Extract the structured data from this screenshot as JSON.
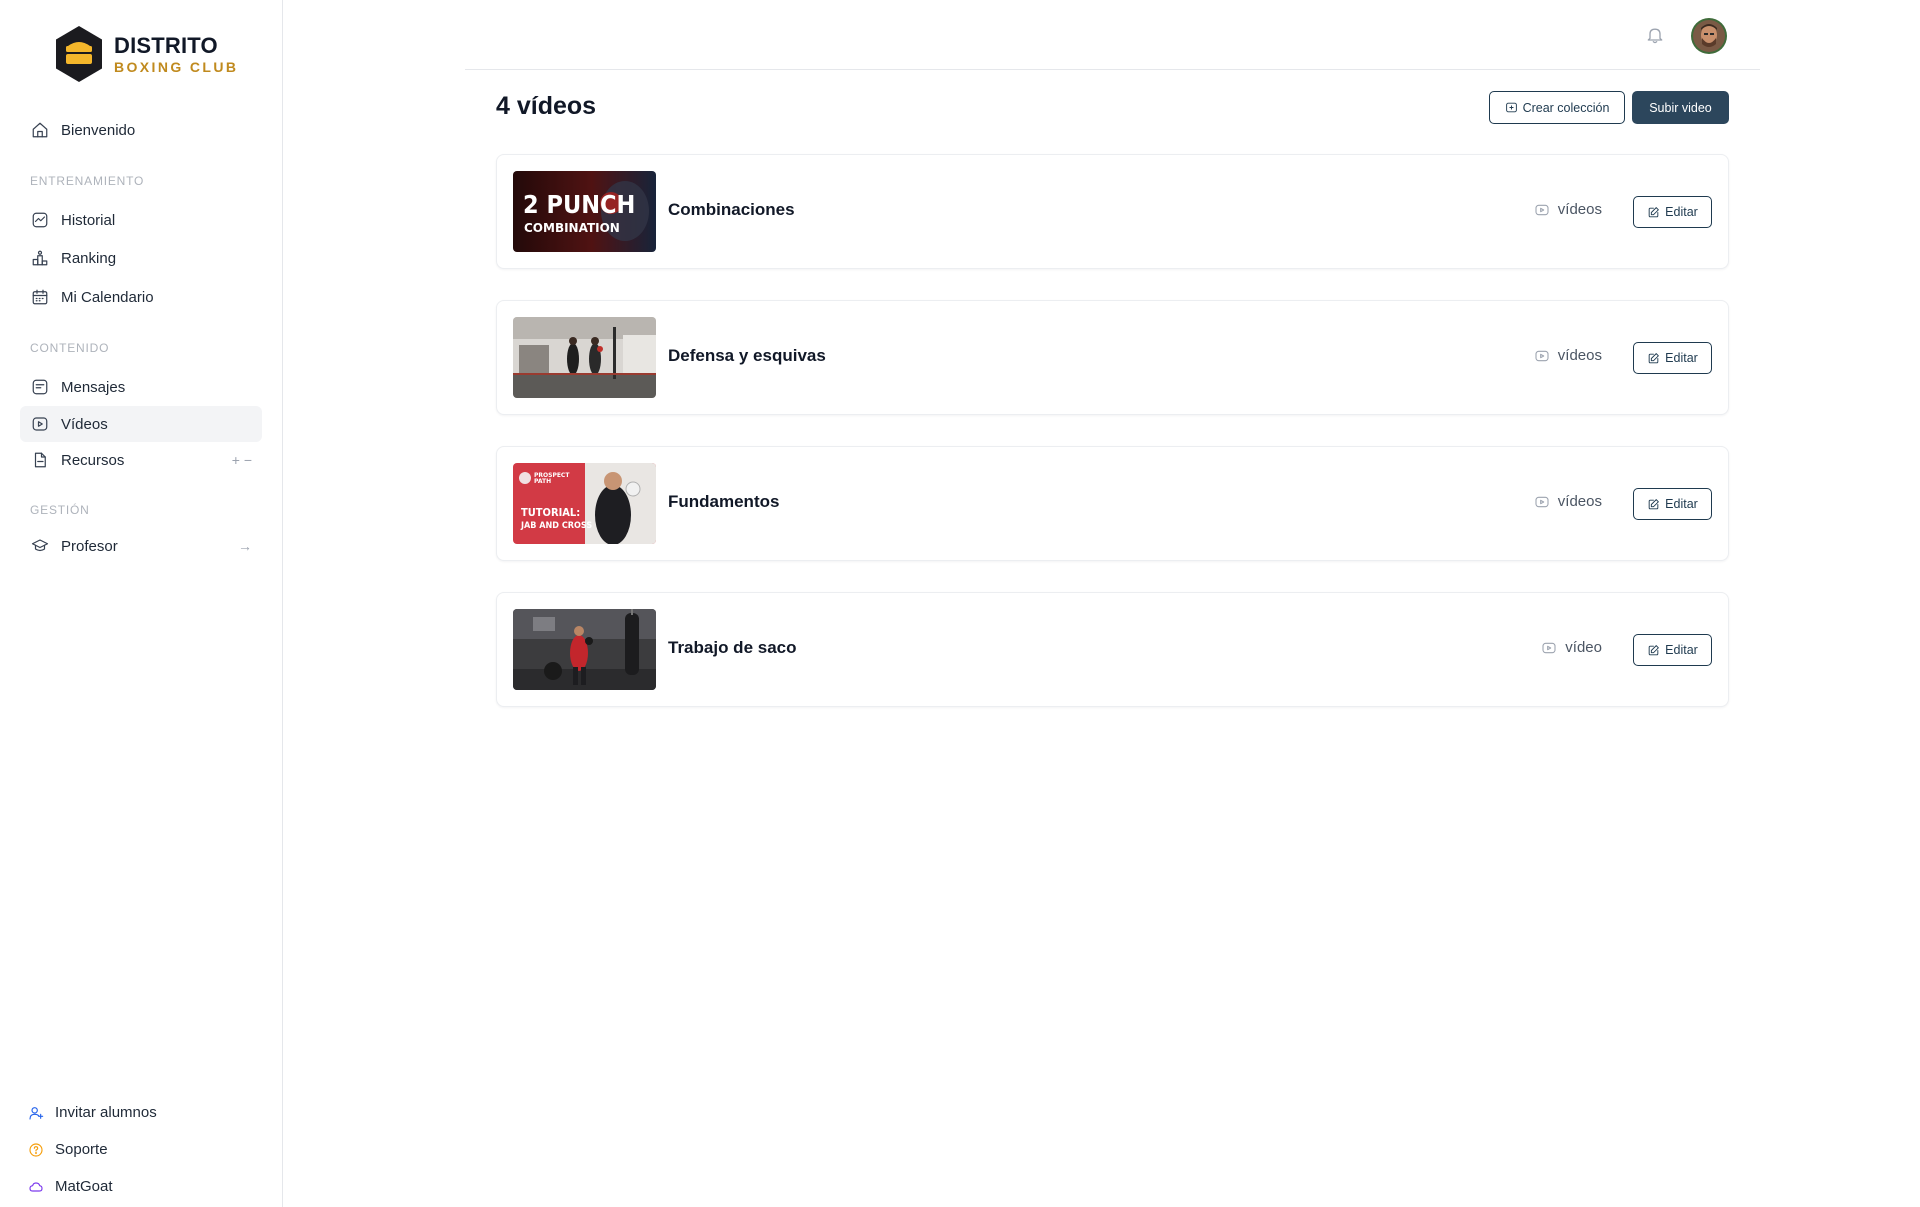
{
  "brand": {
    "line1": "DISTRITO",
    "line2": "BOXING CLUB",
    "logo_icon": "boxing-club-logo",
    "accent_color": "#f5b72b"
  },
  "sidebar": {
    "home": {
      "label": "Bienvenido",
      "icon": "home-icon"
    },
    "sections": [
      {
        "title": "ENTRENAMIENTO",
        "items": [
          {
            "label": "Historial",
            "icon": "activity-chart-icon"
          },
          {
            "label": "Ranking",
            "icon": "podium-icon"
          },
          {
            "label": "Mi Calendario",
            "icon": "calendar-icon"
          }
        ]
      },
      {
        "title": "CONTENIDO",
        "items": [
          {
            "label": "Mensajes",
            "icon": "message-icon"
          },
          {
            "label": "Vídeos",
            "icon": "video-icon",
            "active": true
          },
          {
            "label": "Recursos",
            "icon": "file-icon",
            "trail": "+ −"
          }
        ]
      },
      {
        "title": "GESTIÓN",
        "items": [
          {
            "label": "Profesor",
            "icon": "graduation-cap-icon",
            "trail": "→"
          }
        ]
      }
    ],
    "bottom": [
      {
        "label": "Invitar alumnos",
        "icon": "user-plus-icon",
        "color": "#2563eb"
      },
      {
        "label": "Soporte",
        "icon": "help-circle-icon",
        "color": "#f59e0b"
      },
      {
        "label": "MatGoat",
        "icon": "cloud-icon",
        "color": "#7c3aed"
      }
    ]
  },
  "header": {
    "bell_icon": "bell-icon",
    "avatar": "user-avatar"
  },
  "main": {
    "title": "4 vídeos",
    "create_collection_label": "Crear colección",
    "upload_label": "Subir video",
    "collections": [
      {
        "name": "Combinaciones",
        "count_label": "vídeos",
        "edit_label": "Editar",
        "thumb_text1": "2 PUNCH",
        "thumb_text2": "COMBINATION"
      },
      {
        "name": "Defensa y esquivas",
        "count_label": "vídeos",
        "edit_label": "Editar"
      },
      {
        "name": "Fundamentos",
        "count_label": "vídeos",
        "edit_label": "Editar",
        "thumb_text1": "TUTORIAL:",
        "thumb_text2": "JAB AND CROSS"
      },
      {
        "name": "Trabajo de saco",
        "count_label": "vídeo",
        "edit_label": "Editar"
      }
    ]
  }
}
